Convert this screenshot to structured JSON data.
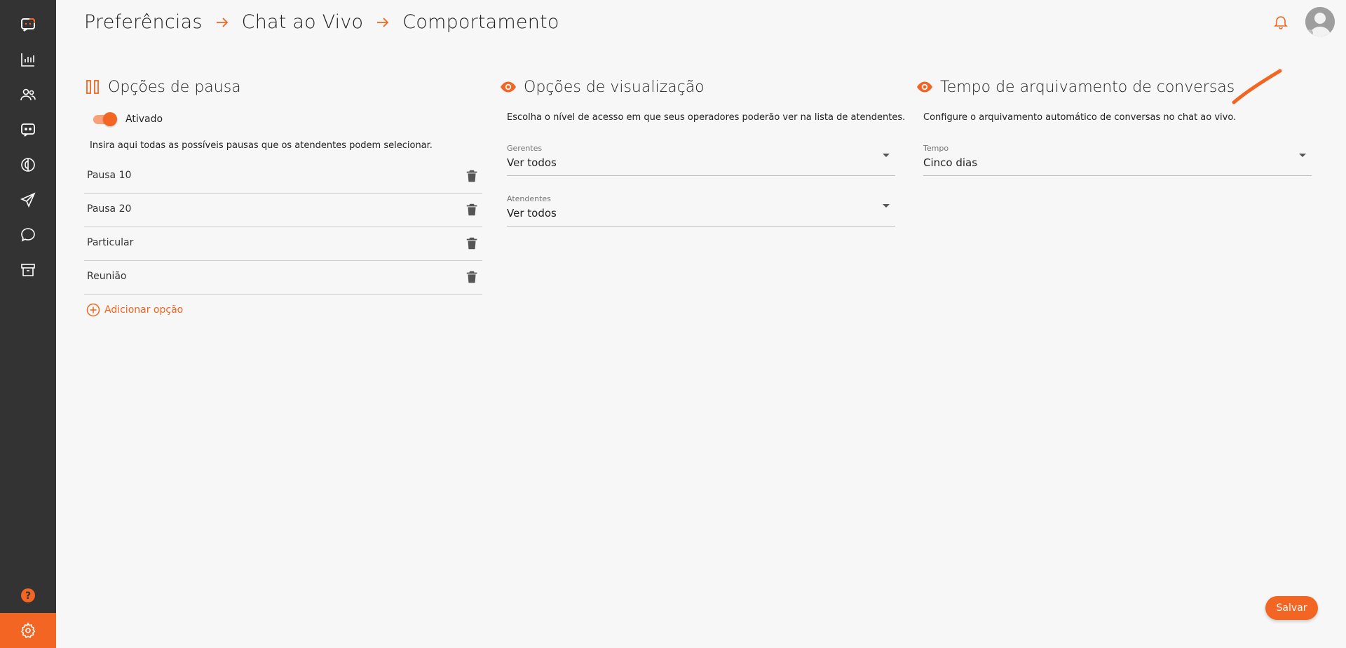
{
  "colors": {
    "accent": "#f26522",
    "sidebar": "#333333"
  },
  "sidebar": {
    "items": [
      {
        "icon": "chat-logo-icon"
      },
      {
        "icon": "bar-chart-icon"
      },
      {
        "icon": "users-icon"
      },
      {
        "icon": "live-chat-icon"
      },
      {
        "icon": "brain-icon"
      },
      {
        "icon": "send-icon"
      },
      {
        "icon": "chat-bubble-icon"
      },
      {
        "icon": "archive-icon"
      }
    ],
    "help_icon": "help-icon",
    "settings_icon": "gear-icon"
  },
  "header": {
    "breadcrumb": [
      "Preferências",
      "Chat ao Vivo",
      "Comportamento"
    ]
  },
  "pause": {
    "title": "Opções de pausa",
    "toggle_label": "Ativado",
    "toggle_on": true,
    "description": "Insira aqui todas as possíveis pausas que os atendentes podem selecionar.",
    "items": [
      "Pausa 10",
      "Pausa 20",
      "Particular",
      "Reunião"
    ],
    "add_label": "Adicionar opção"
  },
  "visual": {
    "title": "Opções de visualização",
    "description": "Escolha o nível de acesso em que seus operadores poderão ver na lista de atendentes.",
    "managers": {
      "label": "Gerentes",
      "value": "Ver todos"
    },
    "agents": {
      "label": "Atendentes",
      "value": "Ver todos"
    }
  },
  "archive": {
    "title": "Tempo de arquivamento de conversas",
    "description": "Configure o arquivamento automático de conversas no chat ao vivo.",
    "time": {
      "label": "Tempo",
      "value": "Cinco dias"
    }
  },
  "save_label": "Salvar"
}
